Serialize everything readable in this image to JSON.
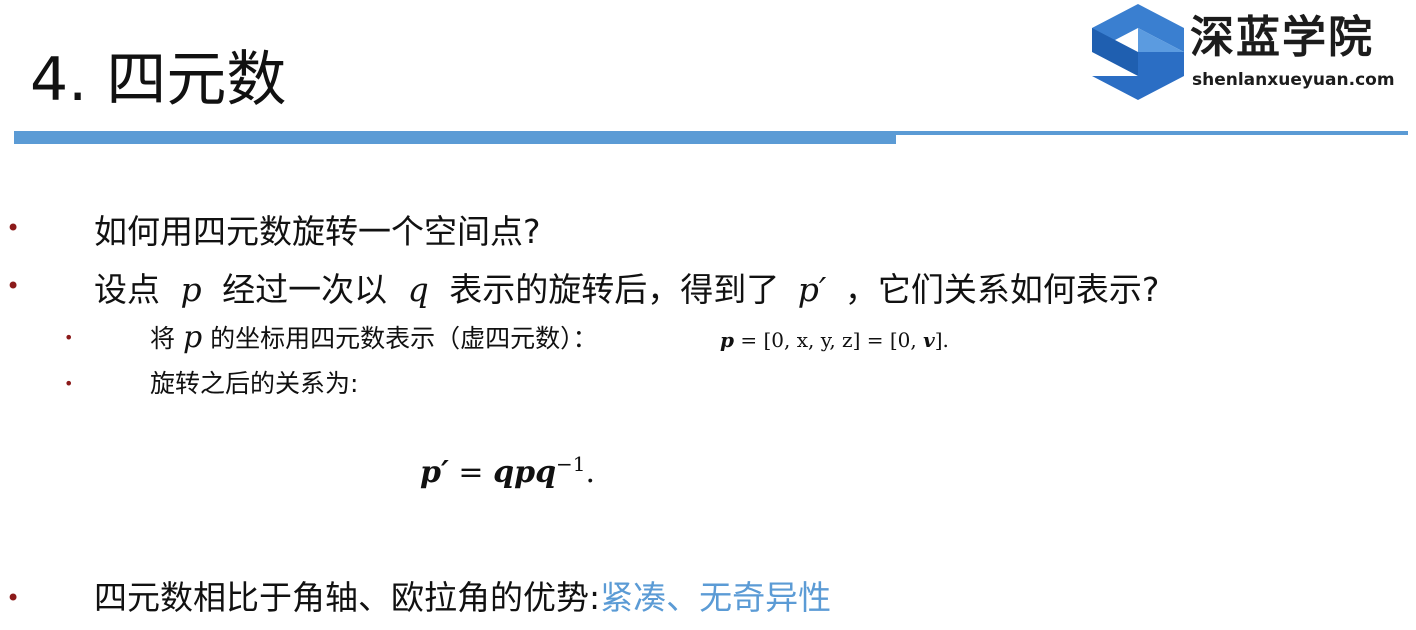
{
  "header": {
    "title": "4. 四元数",
    "logo_cn": "深蓝学院",
    "logo_en": "shenlanxueyuan.com",
    "accent_color": "#5b9bd5",
    "bullet_color": "#8b1a1a"
  },
  "bullets": {
    "b1": {
      "text": "如何用四元数旋转一个空间点?"
    },
    "b2": {
      "t1": "设点",
      "var_p": "p",
      "t2": "经过一次以",
      "var_q": "q",
      "t3": "表示的旋转后，得到了",
      "var_pprime": "p′",
      "t4": "，它们关系如何表示?"
    },
    "b2_sub1": {
      "t1": "将",
      "var_p": "p",
      "t2": "的坐标用四元数表示（虚四元数）：",
      "formula_p": "p",
      "formula_rest": "= [0, x, y, z] = [0, ",
      "formula_v": "v",
      "formula_end": "]."
    },
    "b2_sub2": {
      "text": "旋转之后的关系为:"
    },
    "display_formula": {
      "lhs": "p′",
      "eq": " = ",
      "rhs": "qpq",
      "exp": "−1",
      "end": "."
    },
    "b3": {
      "text": "四元数相比于角轴、欧拉角的优势:",
      "highlight": "紧凑、无奇异性"
    }
  }
}
